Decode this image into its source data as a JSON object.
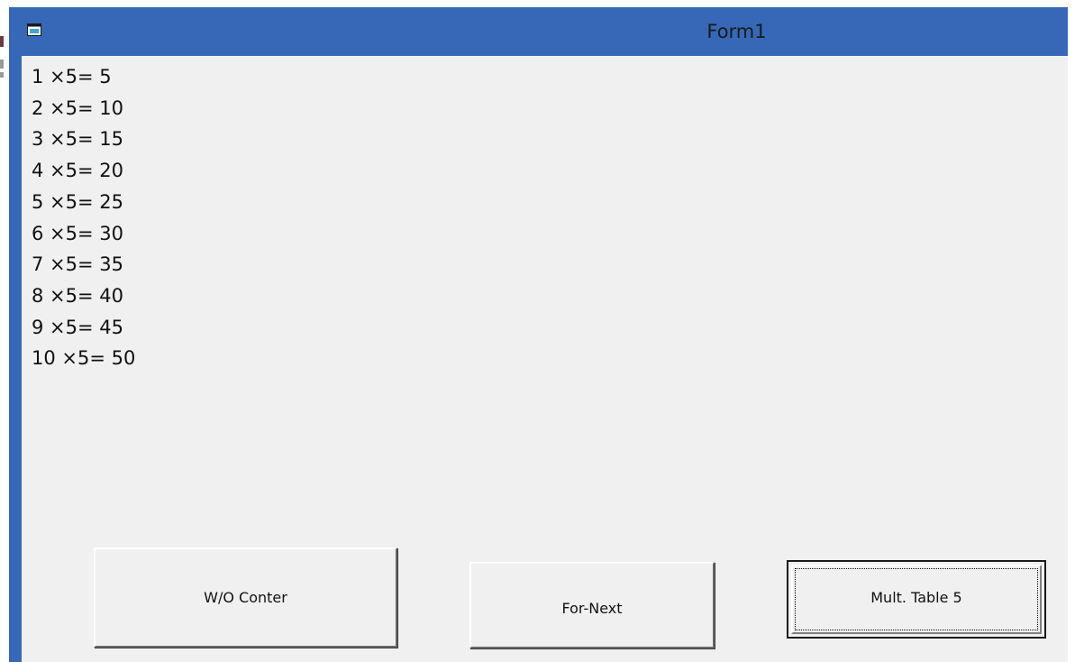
{
  "window": {
    "title": "Form1",
    "icon": "form-window-icon",
    "title_bar_color": "#3668b7",
    "client_color": "#f0f0f0"
  },
  "output": {
    "lines": [
      "1 ×5= 5",
      "2 ×5= 10",
      "3 ×5= 15",
      "4 ×5= 20",
      "5 ×5= 25",
      "6 ×5= 30",
      "7 ×5= 35",
      "8 ×5= 40",
      "9 ×5= 45",
      "10 ×5= 50"
    ]
  },
  "buttons": {
    "without_counter": "W/O Conter",
    "for_next": "For-Next",
    "mult_table": "Mult. Table 5"
  }
}
